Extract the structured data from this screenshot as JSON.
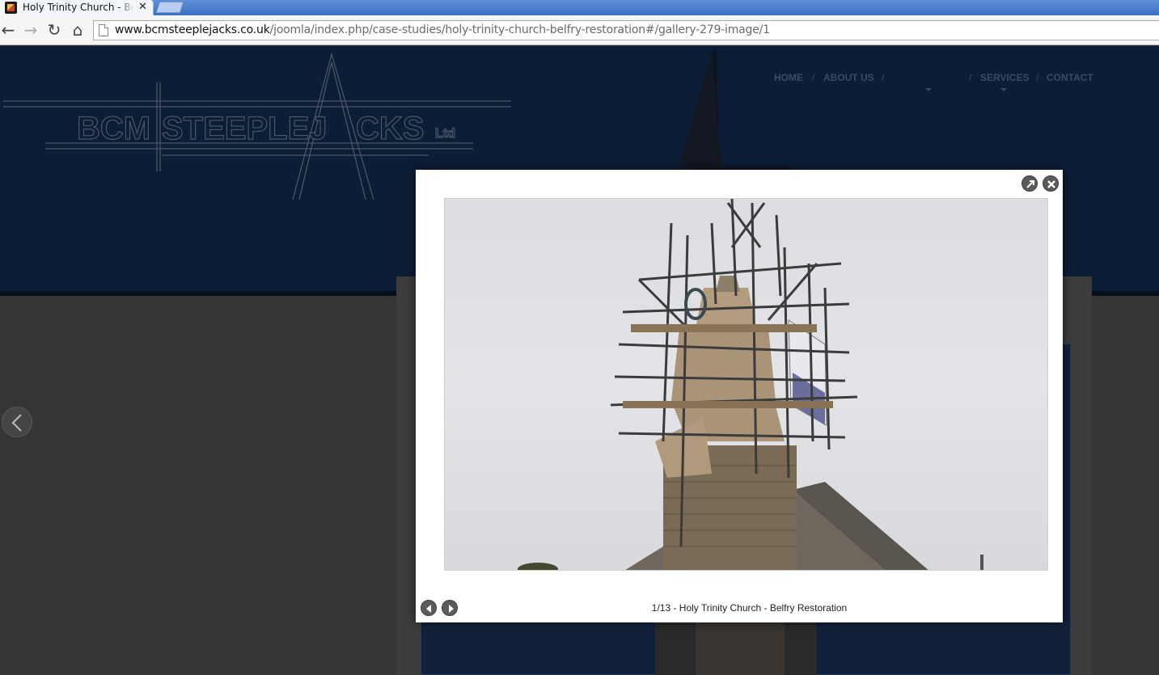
{
  "browser": {
    "tab_title": "Holy Trinity Church - Belfry Restoration",
    "tab_close": "✕",
    "url_host": "www.bcmsteeplejacks.co.uk",
    "url_path": "/joomla/index.php/case-studies/holy-trinity-church-belfry-restoration#/gallery-279-image/1",
    "back_glyph": "←",
    "forward_glyph": "→",
    "reload_glyph": "↻",
    "home_glyph": "⌂"
  },
  "site": {
    "logo": {
      "part1": "BCM",
      "part2": "STEEPLEJ",
      "part3": "CKS",
      "suffix": "Ltd"
    },
    "nav": [
      {
        "label": "HOME"
      },
      {
        "label": "ABOUT US"
      },
      {
        "label": ""
      },
      {
        "label": "SERVICES"
      },
      {
        "label": "CONTACT"
      }
    ],
    "nav_separator": "/"
  },
  "lightbox": {
    "caption": "1/13 - Holy Trinity Church - Belfry Restoration"
  },
  "colors": {
    "header_bg": "#0c1d36",
    "overlay_body": "#353535",
    "lightbox_bg": "#ffffff"
  }
}
